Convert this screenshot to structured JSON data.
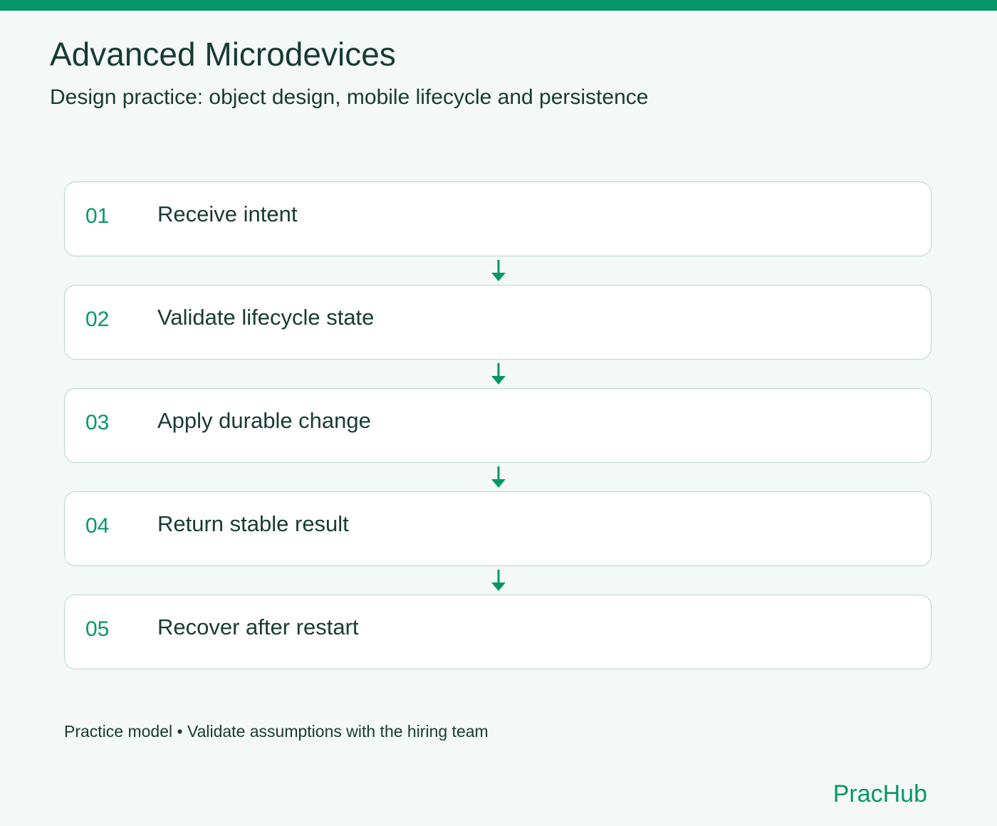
{
  "header": {
    "title": "Advanced Microdevices",
    "subtitle": "Design practice: object design, mobile lifecycle and persistence"
  },
  "steps": [
    {
      "number": "01",
      "label": "Receive intent"
    },
    {
      "number": "02",
      "label": "Validate lifecycle state"
    },
    {
      "number": "03",
      "label": "Apply durable change"
    },
    {
      "number": "04",
      "label": "Return stable result"
    },
    {
      "number": "05",
      "label": "Recover after restart"
    }
  ],
  "footer": {
    "note": "Practice model • Validate assumptions with the hiring team",
    "brand": "PracHub"
  },
  "colors": {
    "accent": "#06966a",
    "text": "#173b32",
    "background": "#f4f8f6",
    "card_border": "#b7d7cc"
  },
  "icons": {
    "connector": "arrow-down-icon"
  }
}
